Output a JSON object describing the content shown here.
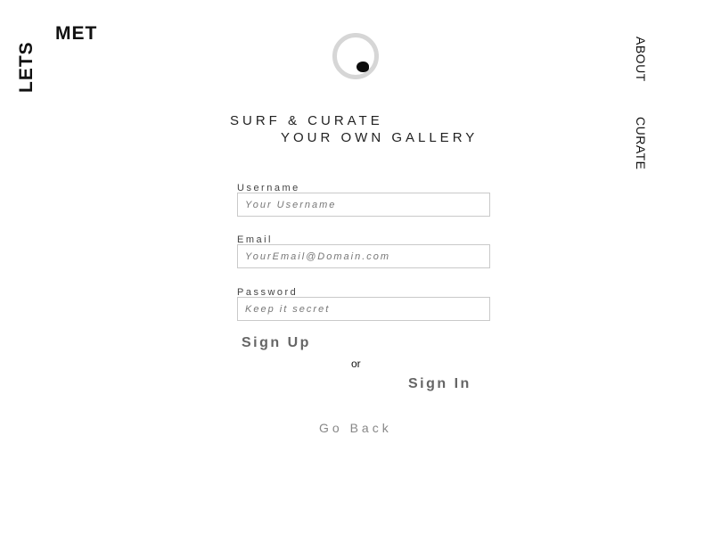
{
  "brand": {
    "word_vertical": "LETS",
    "word_horizontal": "MET"
  },
  "nav": {
    "about": "ABOUT",
    "curate": "CURATE"
  },
  "tagline": {
    "line1": "SURF & CURATE",
    "line2": "YOUR OWN GALLERY"
  },
  "form": {
    "username": {
      "label": "Username",
      "value": "",
      "placeholder": "Your Username"
    },
    "email": {
      "label": "Email",
      "value": "",
      "placeholder": "YourEmail@Domain.com"
    },
    "password": {
      "label": "Password",
      "value": "",
      "placeholder": "Keep it secret"
    }
  },
  "actions": {
    "sign_up": "Sign Up",
    "or": "or",
    "sign_in": "Sign In",
    "go_back": "Go Back"
  },
  "icons": {
    "emblem": "logo-circle-icon"
  },
  "colors": {
    "text": "#111111",
    "muted": "#666666",
    "input_border": "#c9c9c9",
    "emblem_ring": "#d6d6d6",
    "background": "#ffffff"
  }
}
